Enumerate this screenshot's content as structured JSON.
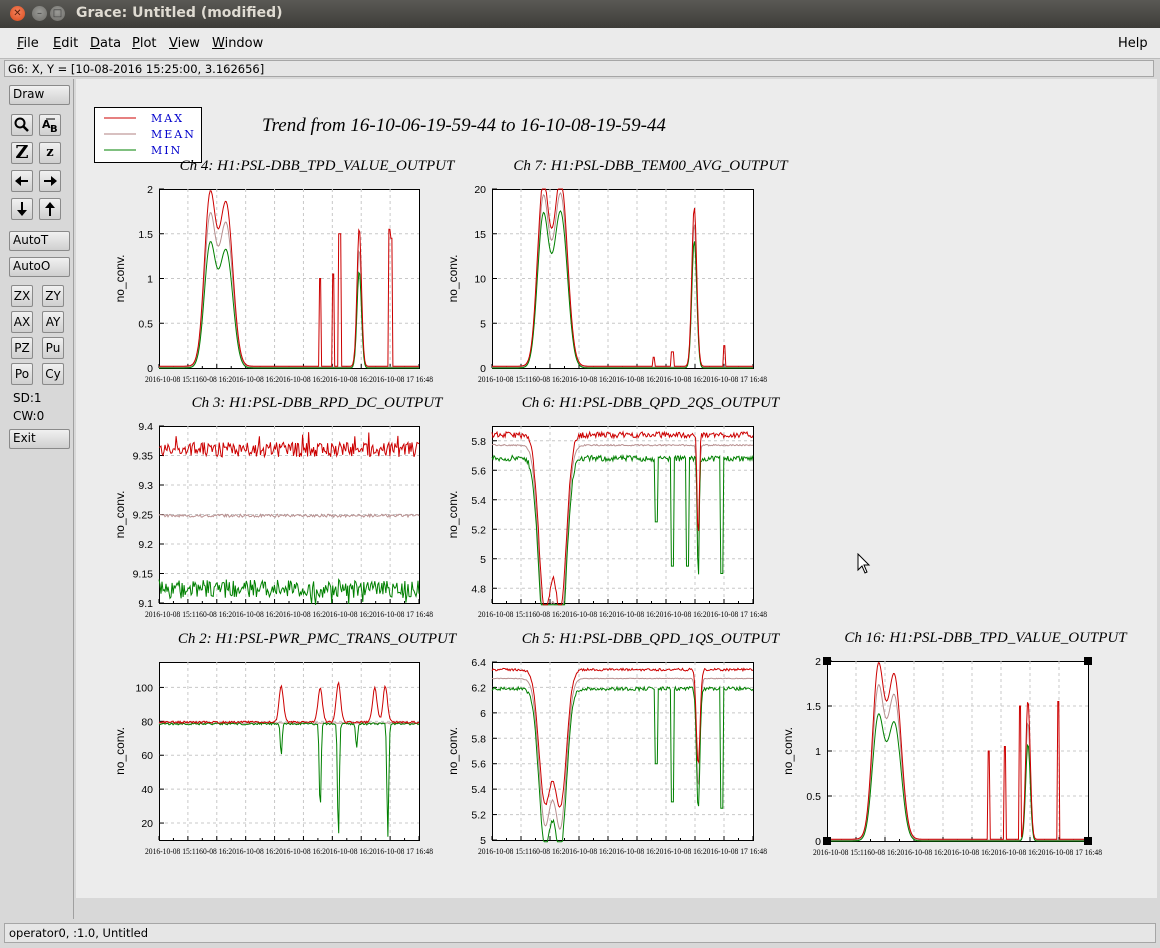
{
  "window": {
    "title": "Grace: Untitled (modified)"
  },
  "menubar": {
    "items": [
      {
        "label": "File",
        "accel": "F"
      },
      {
        "label": "Edit",
        "accel": "E"
      },
      {
        "label": "Data",
        "accel": "D"
      },
      {
        "label": "Plot",
        "accel": "P"
      },
      {
        "label": "View",
        "accel": "V"
      },
      {
        "label": "Window",
        "accel": "W"
      }
    ],
    "help": "Help"
  },
  "locator": "G6: X, Y = [10-08-2016 15:25:00, 3.162656]",
  "toolbar": {
    "draw": "Draw",
    "autot": "AutoT",
    "autoo": "AutoO",
    "zx": "ZX",
    "zy": "ZY",
    "ax": "AX",
    "ay": "AY",
    "pz": "PZ",
    "pu": "Pu",
    "po": "Po",
    "cy": "Cy",
    "sd": "SD:1",
    "cw": "CW:0",
    "exit": "Exit"
  },
  "status": "operator0, :1.0, Untitled",
  "canvas": {
    "main_title": "Trend from 16-10-06-19-59-44 to 16-10-08-19-59-44",
    "legend": [
      {
        "label": "MAX",
        "color": "#cc0000"
      },
      {
        "label": "MEAN",
        "color": "#b08080"
      },
      {
        "label": "MIN",
        "color": "#008000"
      }
    ],
    "legend_text_color": "#0000cc",
    "colors": {
      "max": "#cc0000",
      "mean": "#b89090",
      "min": "#008000",
      "grid": "#c8c8c8"
    }
  },
  "chart_data": [
    {
      "type": "line",
      "title": "Ch 4: H1:PSL-DBB_TPD_VALUE_OUTPUT",
      "ylabel": "no_conv.",
      "ylim": [
        0,
        2
      ],
      "yticks": [
        "0",
        "0.5",
        "1",
        "1.5",
        "2"
      ],
      "ytick_values": [
        0,
        0.5,
        1,
        1.5,
        2
      ],
      "xtick_text": "2016-10-08 15:1160-08 16:2016-10-08 16:2016-10-08 16:2016-10-08 16:2016-10-08 17 16:48",
      "kind": "tpd",
      "series": [
        {
          "name": "MAX"
        },
        {
          "name": "MEAN"
        },
        {
          "name": "MIN"
        }
      ]
    },
    {
      "type": "line",
      "title": "Ch 7: H1:PSL-DBB_TEM00_AVG_OUTPUT",
      "ylabel": "no_conv.",
      "ylim": [
        0,
        20
      ],
      "yticks": [
        "0",
        "5",
        "10",
        "15",
        "20"
      ],
      "ytick_values": [
        0,
        5,
        10,
        15,
        20
      ],
      "xtick_text": "2016-10-08 15:1160-08 16:2016-10-08 16:2016-10-08 16:2016-10-08 16:2016-10-08 17 16:48",
      "kind": "tem",
      "series": [
        {
          "name": "MAX"
        },
        {
          "name": "MEAN"
        },
        {
          "name": "MIN"
        }
      ]
    },
    {
      "type": "line",
      "title": "Ch 3: H1:PSL-DBB_RPD_DC_OUTPUT",
      "ylabel": "no_conv.",
      "ylim": [
        9.1,
        9.4
      ],
      "yticks": [
        "9.1",
        "9.15",
        "9.2",
        "9.25",
        "9.3",
        "9.35",
        "9.4"
      ],
      "ytick_values": [
        9.1,
        9.15,
        9.2,
        9.25,
        9.3,
        9.35,
        9.4
      ],
      "xtick_text": "2016-10-08 15:1160-08 16:2016-10-08 16:2016-10-08 16:2016-10-08 16:2016-10-08 17 16:48",
      "kind": "rpd",
      "series": [
        {
          "name": "MAX"
        },
        {
          "name": "MEAN"
        },
        {
          "name": "MIN"
        }
      ]
    },
    {
      "type": "line",
      "title": "Ch 6: H1:PSL-DBB_QPD_2QS_OUTPUT",
      "ylabel": "no_conv.",
      "ylim": [
        4.7,
        5.9
      ],
      "yticks": [
        "4.8",
        "5",
        "5.2",
        "5.4",
        "5.6",
        "5.8"
      ],
      "ytick_values": [
        4.8,
        5,
        5.2,
        5.4,
        5.6,
        5.8
      ],
      "xtick_text": "2016-10-08 15:1160-08 16:2016-10-08 16:2016-10-08 16:2016-10-08 16:2016-10-08 17 16:48",
      "kind": "qpd2",
      "series": [
        {
          "name": "MAX"
        },
        {
          "name": "MEAN"
        },
        {
          "name": "MIN"
        }
      ]
    },
    {
      "type": "line",
      "title": "Ch 2: H1:PSL-PWR_PMC_TRANS_OUTPUT",
      "ylabel": "no_conv.",
      "ylim": [
        10,
        115
      ],
      "yticks": [
        "20",
        "40",
        "60",
        "80",
        "100"
      ],
      "ytick_values": [
        20,
        40,
        60,
        80,
        100
      ],
      "xtick_text": "2016-10-08 15:1160-08 16:2016-10-08 16:2016-10-08 16:2016-10-08 16:2016-10-08 17 16:48",
      "kind": "pmc",
      "series": [
        {
          "name": "MAX"
        },
        {
          "name": "MEAN"
        },
        {
          "name": "MIN"
        }
      ]
    },
    {
      "type": "line",
      "title": "Ch 5: H1:PSL-DBB_QPD_1QS_OUTPUT",
      "ylabel": "no_conv.",
      "ylim": [
        5,
        6.4
      ],
      "yticks": [
        "5",
        "5.2",
        "5.4",
        "5.6",
        "5.8",
        "6",
        "6.2",
        "6.4"
      ],
      "ytick_values": [
        5,
        5.2,
        5.4,
        5.6,
        5.8,
        6,
        6.2,
        6.4
      ],
      "xtick_text": "2016-10-08 15:1160-08 16:2016-10-08 16:2016-10-08 16:2016-10-08 16:2016-10-08 17 16:48",
      "kind": "qpd1",
      "series": [
        {
          "name": "MAX"
        },
        {
          "name": "MEAN"
        },
        {
          "name": "MIN"
        }
      ]
    },
    {
      "type": "line",
      "title": "Ch 16: H1:PSL-DBB_TPD_VALUE_OUTPUT",
      "ylabel": "no_conv.",
      "ylim": [
        0,
        2
      ],
      "yticks": [
        "0",
        "0.5",
        "1",
        "1.5",
        "2"
      ],
      "ytick_values": [
        0,
        0.5,
        1,
        1.5,
        2
      ],
      "xtick_text": "2016-10-08 15:1160-08 16:2016-10-08 16:2016-10-08 16:2016-10-08 16:2016-10-08 17 16:48",
      "kind": "tpd2",
      "selected": true,
      "series": [
        {
          "name": "MAX"
        },
        {
          "name": "MEAN"
        },
        {
          "name": "MIN"
        }
      ]
    }
  ]
}
